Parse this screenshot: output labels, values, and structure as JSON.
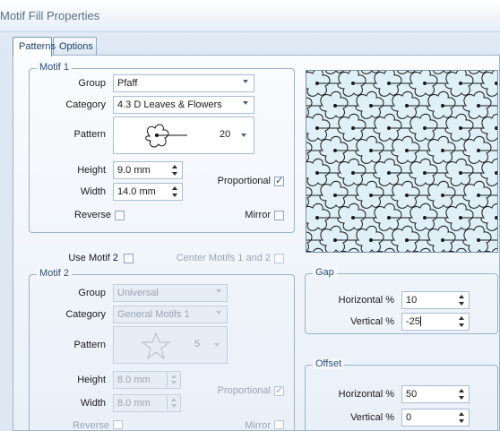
{
  "window": {
    "title": "Motif Fill Properties"
  },
  "tabs": [
    {
      "label": "Patterns",
      "active": true
    },
    {
      "label": "Options",
      "active": false
    }
  ],
  "motif1": {
    "legend": "Motif 1",
    "group_label": "Group",
    "group_value": "Pfaff",
    "category_label": "Category",
    "category_value": "4.3 D Leaves & Flowers",
    "pattern_label": "Pattern",
    "pattern_number": "20",
    "height_label": "Height",
    "height_value": "9.0 mm",
    "width_label": "Width",
    "width_value": "14.0 mm",
    "proportional_label": "Proportional",
    "proportional_checked": true,
    "reverse_label": "Reverse",
    "reverse_checked": false,
    "mirror_label": "Mirror",
    "mirror_checked": false
  },
  "use_motif2": {
    "label": "Use Motif 2",
    "checked": false
  },
  "center_motifs": {
    "label": "Center Motifs 1 and 2",
    "checked": false
  },
  "motif2": {
    "legend": "Motif 2",
    "group_label": "Group",
    "group_value": "Universal",
    "category_label": "Category",
    "category_value": "General Motifs 1",
    "pattern_label": "Pattern",
    "pattern_number": "5",
    "height_label": "Height",
    "height_value": "8.0 mm",
    "width_label": "Width",
    "width_value": "8.0 mm",
    "proportional_label": "Proportional",
    "proportional_checked": true,
    "reverse_label": "Reverse",
    "mirror_label": "Mirror"
  },
  "gap": {
    "legend": "Gap",
    "horizontal_label": "Horizontal %",
    "horizontal_value": "10",
    "vertical_label": "Vertical %",
    "vertical_value": "-25"
  },
  "offset": {
    "legend": "Offset",
    "horizontal_label": "Horizontal %",
    "horizontal_value": "50",
    "vertical_label": "Vertical %",
    "vertical_value": "0"
  },
  "colors": {
    "accent": "#2b4f7b",
    "preview_bg": "#dff0f8",
    "disabled_text": "#9aa5b2"
  }
}
